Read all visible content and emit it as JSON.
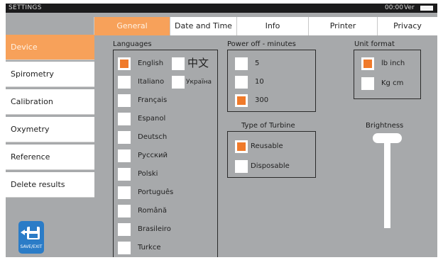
{
  "titlebar": {
    "title": "SETTINGS",
    "clock": "00:00",
    "version_label": "Ver"
  },
  "tabs": [
    {
      "label": "General",
      "active": true
    },
    {
      "label": "Date and Time",
      "active": false
    },
    {
      "label": "Info",
      "active": false
    },
    {
      "label": "Printer",
      "active": false
    },
    {
      "label": "Privacy",
      "active": false
    }
  ],
  "sidebar": {
    "items": [
      {
        "label": "Device",
        "active": true
      },
      {
        "label": "Spirometry",
        "active": false
      },
      {
        "label": "Calibration",
        "active": false
      },
      {
        "label": "Oxymetry",
        "active": false
      },
      {
        "label": "Reference",
        "active": false
      },
      {
        "label": "Delete results",
        "active": false
      }
    ],
    "save_label": "SAVE/EXIT"
  },
  "languages": {
    "heading": "Languages",
    "items": [
      {
        "label": "English",
        "checked": true
      },
      {
        "label": "中文",
        "checked": false
      },
      {
        "label": "Italiano",
        "checked": false
      },
      {
        "label": "Україна",
        "checked": false
      },
      {
        "label": "Français",
        "checked": false
      },
      {
        "label": "Espanol",
        "checked": false
      },
      {
        "label": "Deutsch",
        "checked": false
      },
      {
        "label": "Русский",
        "checked": false
      },
      {
        "label": "Polski",
        "checked": false
      },
      {
        "label": "Português",
        "checked": false
      },
      {
        "label": "Română",
        "checked": false
      },
      {
        "label": "Brasileiro",
        "checked": false
      },
      {
        "label": "Turkce",
        "checked": false
      }
    ]
  },
  "power_off": {
    "heading": "Power off - minutes",
    "items": [
      {
        "label": "5",
        "checked": false
      },
      {
        "label": "10",
        "checked": false
      },
      {
        "label": "300",
        "checked": true
      }
    ]
  },
  "turbine": {
    "heading": "Type of Turbine",
    "items": [
      {
        "label": "Reusable",
        "checked": true
      },
      {
        "label": "Disposable",
        "checked": false
      }
    ]
  },
  "unit_format": {
    "heading": "Unit format",
    "items": [
      {
        "label": "lb inch",
        "checked": true
      },
      {
        "label": "Kg cm",
        "checked": false
      }
    ]
  },
  "brightness": {
    "heading": "Brightness",
    "level": 1.0
  },
  "colors": {
    "accent": "#f7a15a",
    "check": "#f07a2a",
    "panel": "#a7a9ab",
    "save": "#2b7cc7"
  }
}
